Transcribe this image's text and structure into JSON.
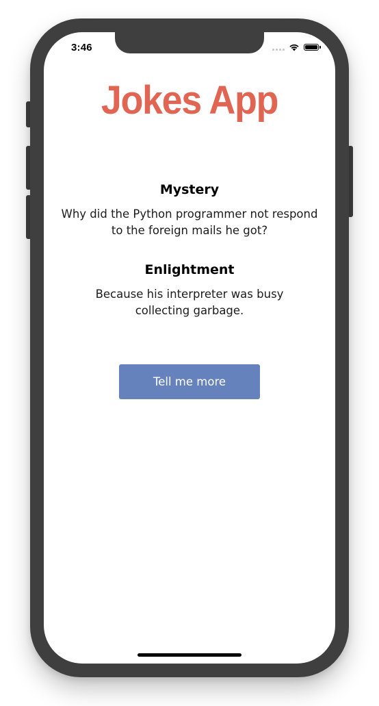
{
  "status_bar": {
    "time": "3:46"
  },
  "app": {
    "title": "Jokes App",
    "title_color": "#e06553"
  },
  "mystery": {
    "heading": "Mystery",
    "text": "Why did the Python programmer not respond to the foreign mails he got?"
  },
  "enlightment": {
    "heading": "Enlightment",
    "text": "Because his interpreter was busy collecting garbage."
  },
  "actions": {
    "more_label": "Tell me more",
    "button_color": "#6582bd"
  },
  "icons": {
    "signal": "cellular-signal-icon",
    "wifi": "wifi-icon",
    "battery": "battery-icon"
  }
}
